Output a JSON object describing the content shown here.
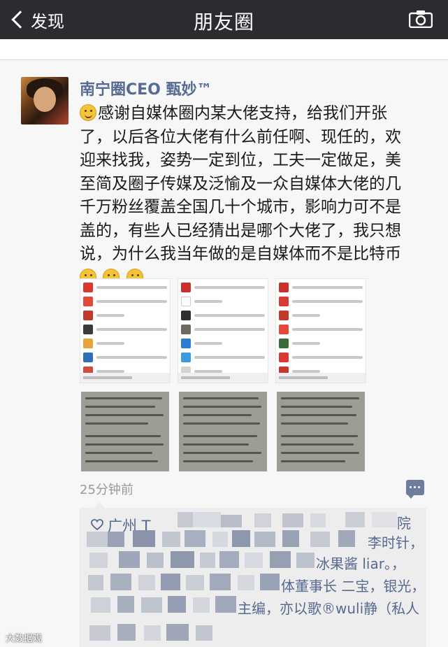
{
  "nav": {
    "back_label": "发现",
    "title": "朋友圈",
    "camera_icon": "camera-icon"
  },
  "post": {
    "author": "南宁圈CEO 甄妙™",
    "text_lines": [
      "感谢自媒体圈内某大佬支持，给我们开张",
      "了，以后各位大佬有什么前任啊、现任的，欢",
      "迎来找我，姿势一定到位，工夫一定做足，美",
      "至简及圈子传媒及泛愉及一众自媒体大佬的几",
      "千万粉丝覆盖全国几十个城市，影响力可不是",
      "盖的，有些人已经猜出是哪个大佬了，我只想",
      "说，为什么我当年做的是自媒体而不是比特币"
    ],
    "emojis": [
      "smile-emoji",
      "thinking-emoji",
      "thinking-emoji",
      "thinking-emoji"
    ],
    "timestamp": "25分钟前"
  },
  "likes": {
    "prefix": "广州 T",
    "fragments": {
      "f1": "院",
      "f2": "李时针，",
      "f3": "冰果酱 liar。，",
      "f4": "体董事长 二宝，银光，",
      "f5": "主编，亦以歌®wuli静（私人"
    }
  },
  "watermark": "大数据观",
  "colors": {
    "nav_bg": "#2c2c30",
    "name_blue": "#566a92"
  }
}
